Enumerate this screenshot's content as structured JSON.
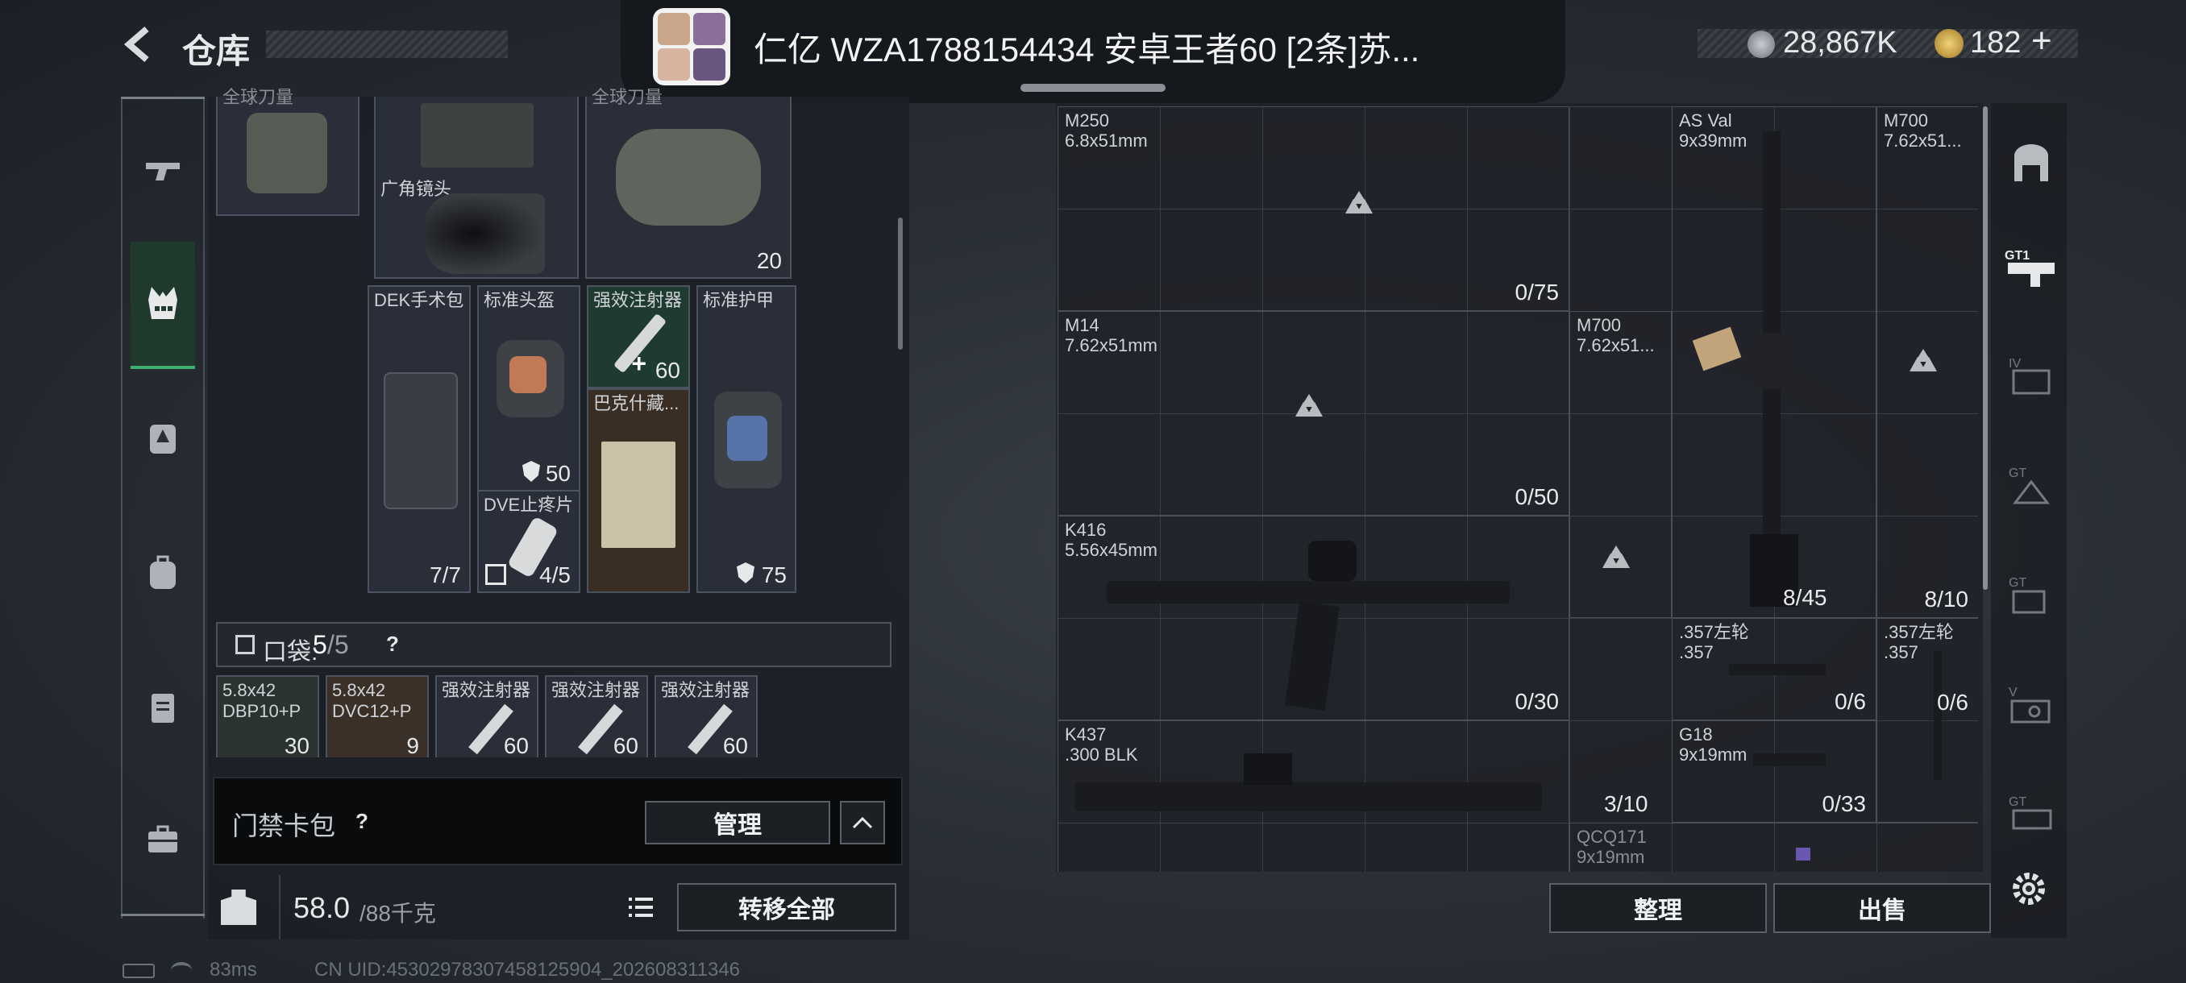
{
  "header": {
    "back_icon": "chevron-left-icon",
    "title": "仓库",
    "currency1": "28,867K",
    "currency2": "182",
    "plus": "+"
  },
  "banner": {
    "text": "仁亿 WZA1788154434 安卓王者60 [2条]苏..."
  },
  "left_panel": {
    "top_items": [
      {
        "name": "全球刀量",
        "count": ""
      },
      {
        "name": "广角镜头",
        "count": ""
      },
      {
        "name": "全球刀量",
        "count": "20"
      }
    ],
    "items": [
      {
        "name": "DEK手术包",
        "count": "7/7"
      },
      {
        "name": "标准头盔",
        "count": "50"
      },
      {
        "name": "强效注射器",
        "count": "60"
      },
      {
        "name": "标准护甲",
        "count": "75"
      },
      {
        "name": "DVE止疼片",
        "count": "4/5"
      },
      {
        "name": "巴克什藏...",
        "count": ""
      }
    ],
    "pocket_label": "口袋:",
    "pocket_used": "5",
    "pocket_total": "/5",
    "help": "?",
    "pocket_items": [
      {
        "name": "5.8x42\nDBP10+P",
        "count": "30"
      },
      {
        "name": "5.8x42\nDVC12+P",
        "count": "9"
      },
      {
        "name": "强效注射器",
        "count": "60"
      },
      {
        "name": "强效注射器",
        "count": "60"
      },
      {
        "name": "强效注射器",
        "count": "60"
      }
    ],
    "keycard_label": "门禁卡包",
    "keycard_help": "?",
    "manage_label": "管理",
    "weight_value": "58.0",
    "weight_max": "/88千克",
    "transfer_all_label": "转移全部"
  },
  "weapons": [
    {
      "name": "M250\n6.8x51mm",
      "count": "0/75"
    },
    {
      "name": "AS Val\n9x39mm",
      "count": ""
    },
    {
      "name": "M700\n7.62x51...",
      "count": "8/10"
    },
    {
      "name": "M14\n7.62x51mm",
      "count": "0/50"
    },
    {
      "name": "M700\n7.62x51...",
      "count": "8/45"
    },
    {
      "name": "K416\n5.56x45mm",
      "count": "0/30"
    },
    {
      "name": ".357左轮\n.357",
      "count": "0/6"
    },
    {
      "name": ".357左轮\n.357",
      "count": "0/6"
    },
    {
      "name": "K437\n.300 BLK",
      "count": "3/10"
    },
    {
      "name": "G18\n9x19mm",
      "count": "0/33"
    },
    {
      "name": "QCQ171\n9x19mm",
      "count": ""
    }
  ],
  "actions": {
    "sort_label": "整理",
    "sell_label": "出售"
  },
  "footer": {
    "ping": "83ms",
    "uid": "CN UID:45302978307458125904_202608311346"
  },
  "colors": {
    "panel": "#20242b",
    "cell": "#2a2e38",
    "border": "#4c5360",
    "accent_green": "#3fae6f"
  }
}
